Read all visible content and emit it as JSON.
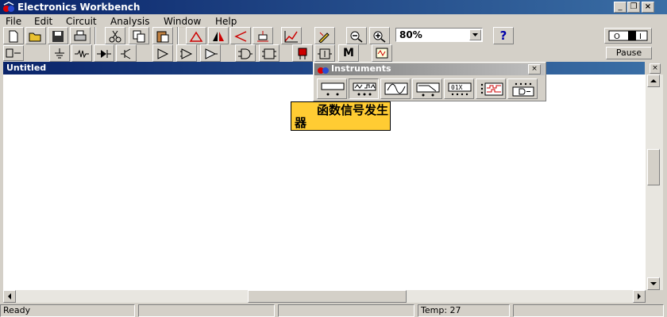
{
  "window": {
    "title": "Electronics Workbench",
    "minimize": "_",
    "restore": "❐",
    "close": "×"
  },
  "menu": [
    {
      "label": "File",
      "mnemonic": "F"
    },
    {
      "label": "Edit",
      "mnemonic": "E"
    },
    {
      "label": "Circuit",
      "mnemonic": "C"
    },
    {
      "label": "Analysis",
      "mnemonic": "A"
    },
    {
      "label": "Window",
      "mnemonic": "W"
    },
    {
      "label": "Help",
      "mnemonic": "H"
    }
  ],
  "toolbar": {
    "zoom_value": "80%",
    "help_label": "?",
    "pause_label": "Pause",
    "power_label": "O I",
    "misc_label": "M"
  },
  "document": {
    "title": "Untitled",
    "close": "×"
  },
  "instruments": {
    "title": "Instruments",
    "close": "×",
    "tooltip": "函数信号发生器",
    "colors": {
      "title_start": "#808080",
      "title_end": "#c0c0c0"
    }
  },
  "statusbar": {
    "ready": "Ready",
    "temp": "Temp:  27"
  },
  "colors": {
    "titlebar": "#0a246a",
    "tooltip_bg": "#ffcc33",
    "face": "#d4d0c8"
  }
}
